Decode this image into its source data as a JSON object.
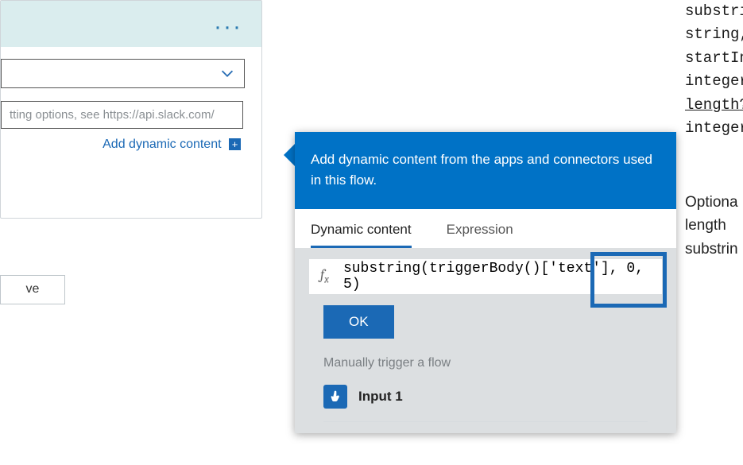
{
  "card": {
    "placeholder_text": "tting options, see https://api.slack.com/",
    "adc_label": "Add dynamic content"
  },
  "save_label": "ve",
  "flyout": {
    "header": "Add dynamic content from the apps and connectors used in this flow.",
    "tab_dynamic": "Dynamic content",
    "tab_expression": "Expression",
    "expression": "substring(triggerBody()['text'], 0, 5)",
    "ok_label": "OK",
    "section_label": "Manually trigger a flow",
    "item1_label": "Input 1"
  },
  "syntax": {
    "l1": "substri",
    "l2": "string,",
    "l3": "startIn",
    "l4": "integer",
    "l5": "length",
    "l6": "integer"
  },
  "desc": {
    "l1": "Optiona",
    "l2": "length",
    "l3": "substrin"
  },
  "chart_data": null
}
